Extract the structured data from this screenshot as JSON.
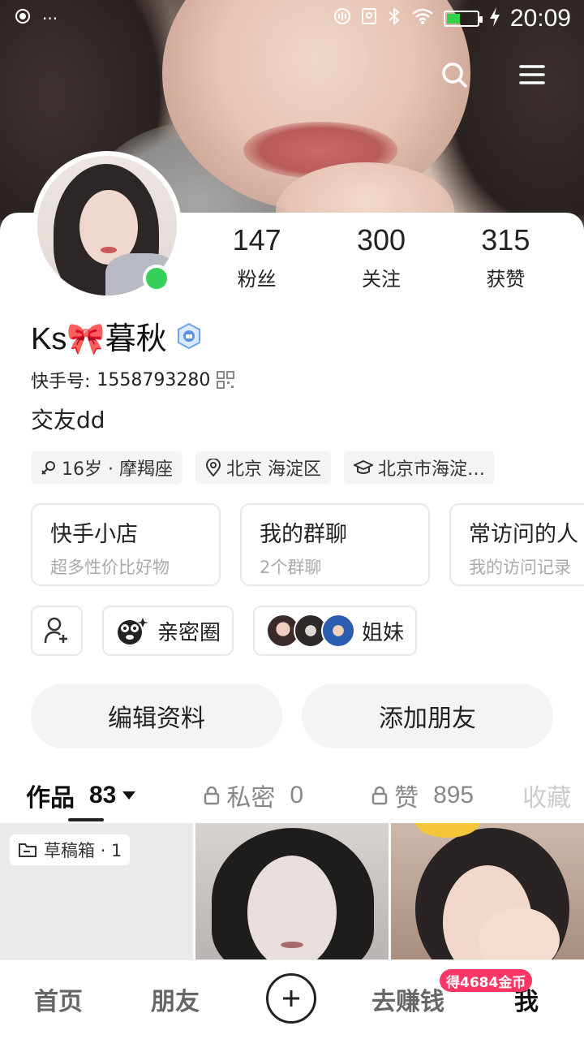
{
  "status_bar": {
    "time": "20:09",
    "dots": "···"
  },
  "profile": {
    "stats": [
      {
        "value": "147",
        "label": "粉丝"
      },
      {
        "value": "300",
        "label": "关注"
      },
      {
        "value": "315",
        "label": "获赞"
      }
    ],
    "name": "Ks🎀暮秋",
    "kuaishou_id_label": "快手号:",
    "kuaishou_id": "1558793280",
    "bio": "交友dd",
    "tags": [
      {
        "icon": "gender-female-icon",
        "text": "16岁 · 摩羯座"
      },
      {
        "icon": "location-pin-icon",
        "text": "北京  海淀区"
      },
      {
        "icon": "school-cap-icon",
        "text": "北京市海淀…"
      }
    ]
  },
  "feature_cards": [
    {
      "title": "快手小店",
      "subtitle": "超多性价比好物"
    },
    {
      "title": "我的群聊",
      "subtitle": "2个群聊"
    },
    {
      "title": "常访问的人",
      "subtitle": "我的访问记录"
    }
  ],
  "social": {
    "intimate_circle": "亲密圈",
    "group": "姐妹"
  },
  "actions": {
    "edit_profile": "编辑资料",
    "add_friend": "添加朋友"
  },
  "tabs": [
    {
      "label": "作品",
      "count": "83",
      "active": true
    },
    {
      "label": "私密",
      "count": "0",
      "locked": true
    },
    {
      "label": "赞",
      "count": "895",
      "locked": true
    },
    {
      "label": "收藏"
    }
  ],
  "grid": {
    "draft_label": "草稿箱 · 1"
  },
  "nav": {
    "home": "首页",
    "friends": "朋友",
    "earn": "去赚钱",
    "me": "我",
    "earn_badge": "得4684金币"
  },
  "colors": {
    "online": "#36d05b",
    "badge": "#fe3666",
    "battery": "#35d04a"
  }
}
